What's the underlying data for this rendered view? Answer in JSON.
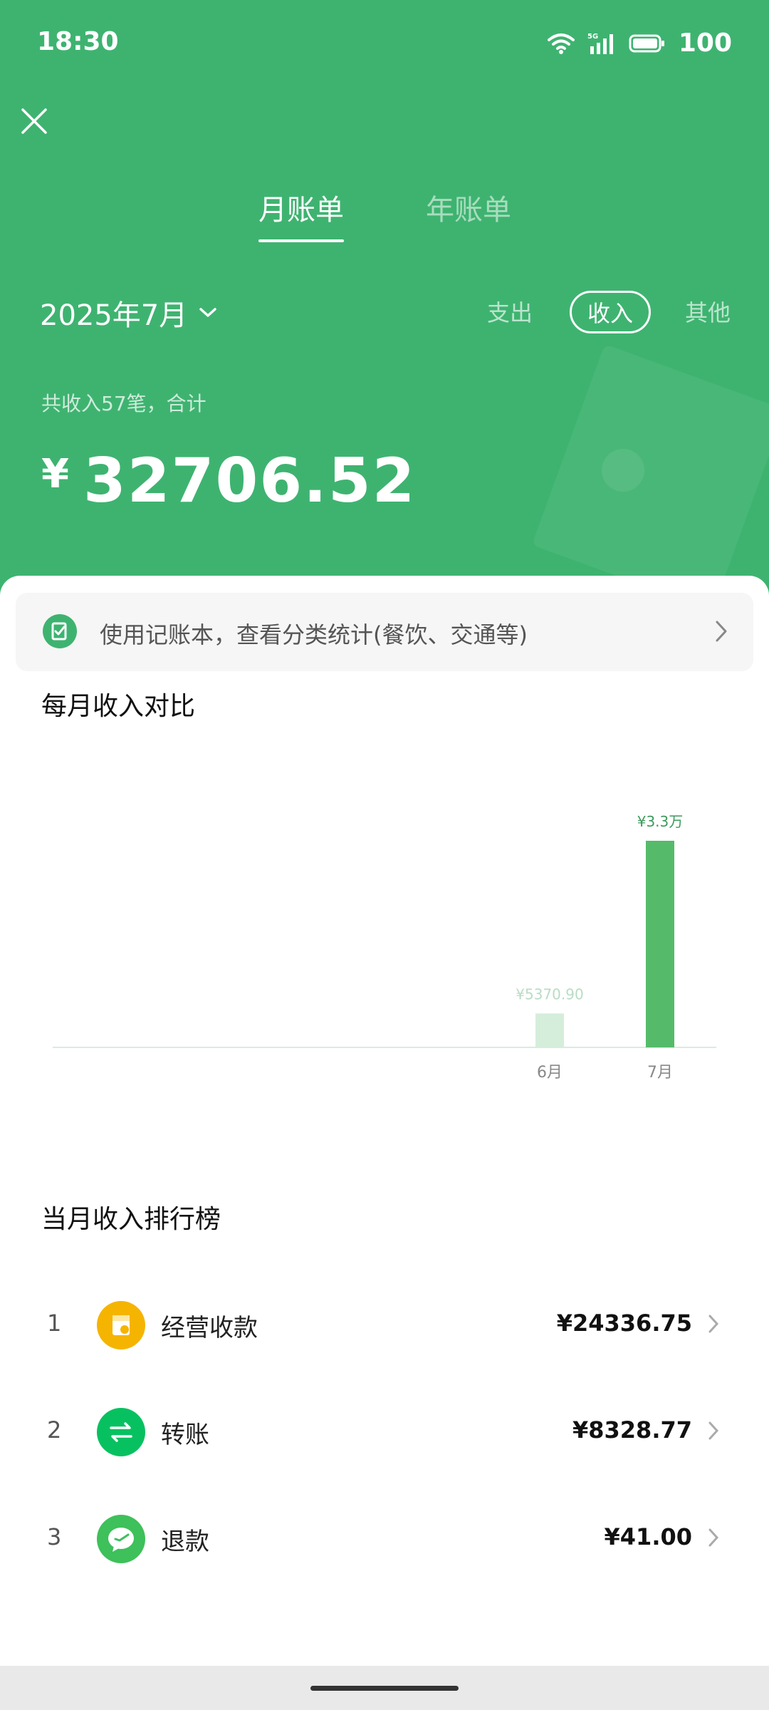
{
  "colors": {
    "header_bg": "#3eb370",
    "bar_current": "#55bb6a",
    "bar_previous": "#d5eedb",
    "accent": "#3eb370"
  },
  "status_bar": {
    "time": "18:30",
    "battery": "100",
    "network": "5G"
  },
  "tabs": [
    {
      "label": "月账单",
      "active": true
    },
    {
      "label": "年账单",
      "active": false
    }
  ],
  "month_picker": {
    "label": "2025年7月"
  },
  "filters": [
    {
      "label": "支出",
      "active": false
    },
    {
      "label": "收入",
      "active": true
    },
    {
      "label": "其他",
      "active": false
    }
  ],
  "summary": {
    "label": "共收入57笔，合计",
    "currency": "¥",
    "amount": "32706.52"
  },
  "banner": {
    "text": "使用记账本，查看分类统计(餐饮、交通等)"
  },
  "chart_section": {
    "title": "每月收入对比"
  },
  "chart_data": {
    "type": "bar",
    "title": "每月收入对比",
    "categories": [
      "6月",
      "7月"
    ],
    "values": [
      5370.9,
      32706.52
    ],
    "value_labels": [
      "¥5370.90",
      "¥3.3万"
    ],
    "xlabel": "",
    "ylabel": "",
    "grid": false
  },
  "ranking": {
    "title": "当月收入排行榜",
    "items": [
      {
        "rank": "1",
        "name": "经营收款",
        "amount": "¥24336.75",
        "icon": "shop-icon",
        "color": "#f5b400"
      },
      {
        "rank": "2",
        "name": "转账",
        "amount": "¥8328.77",
        "icon": "transfer-icon",
        "color": "#07c160"
      },
      {
        "rank": "3",
        "name": "退款",
        "amount": "¥41.00",
        "icon": "refund-icon",
        "color": "#3ec05a"
      }
    ]
  }
}
